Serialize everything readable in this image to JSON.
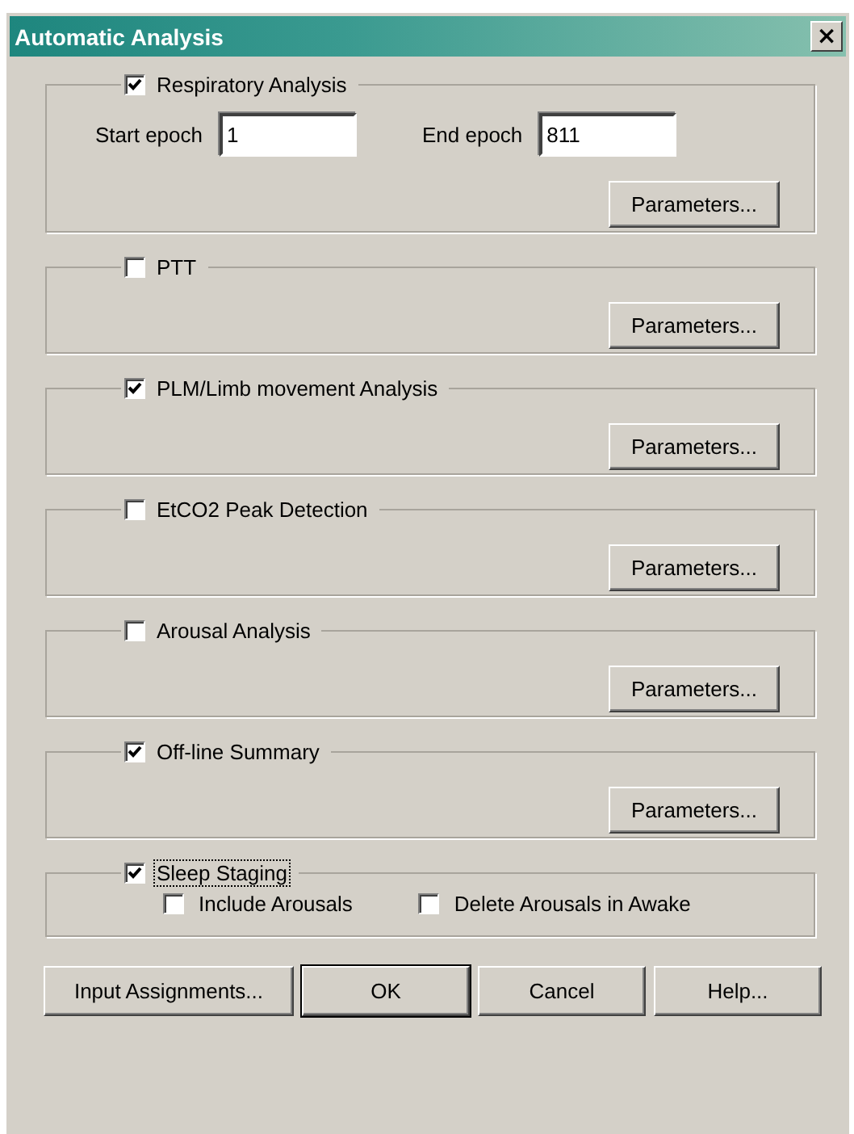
{
  "window": {
    "title": "Automatic Analysis",
    "close": "×"
  },
  "groups": [
    {
      "kind": "epochs",
      "label": "Respiratory Analysis",
      "checked": true,
      "focused": false,
      "fields": [
        {
          "label": "Start epoch",
          "value": "1"
        },
        {
          "label": "End epoch",
          "value": "811"
        }
      ],
      "button": "Parameters..."
    },
    {
      "kind": "simple",
      "label": "PTT",
      "checked": false,
      "focused": false,
      "button": "Parameters..."
    },
    {
      "kind": "simple",
      "label": "PLM/Limb movement Analysis",
      "checked": true,
      "focused": false,
      "button": "Parameters..."
    },
    {
      "kind": "simple",
      "label": "EtCO2 Peak Detection",
      "checked": false,
      "focused": false,
      "button": "Parameters..."
    },
    {
      "kind": "simple",
      "label": "Arousal Analysis",
      "checked": false,
      "focused": false,
      "button": "Parameters..."
    },
    {
      "kind": "simple",
      "label": "Off-line Summary",
      "checked": true,
      "focused": false,
      "button": "Parameters..."
    },
    {
      "kind": "options",
      "label": "Sleep Staging",
      "checked": true,
      "focused": true,
      "options": [
        {
          "label": "Include Arousals",
          "checked": false
        },
        {
          "label": "Delete Arousals in Awake",
          "checked": false
        }
      ]
    }
  ],
  "buttons": [
    {
      "label": "Input Assignments...",
      "default": false
    },
    {
      "label": "OK",
      "default": true
    },
    {
      "label": "Cancel",
      "default": false
    },
    {
      "label": "Help...",
      "default": false
    }
  ]
}
